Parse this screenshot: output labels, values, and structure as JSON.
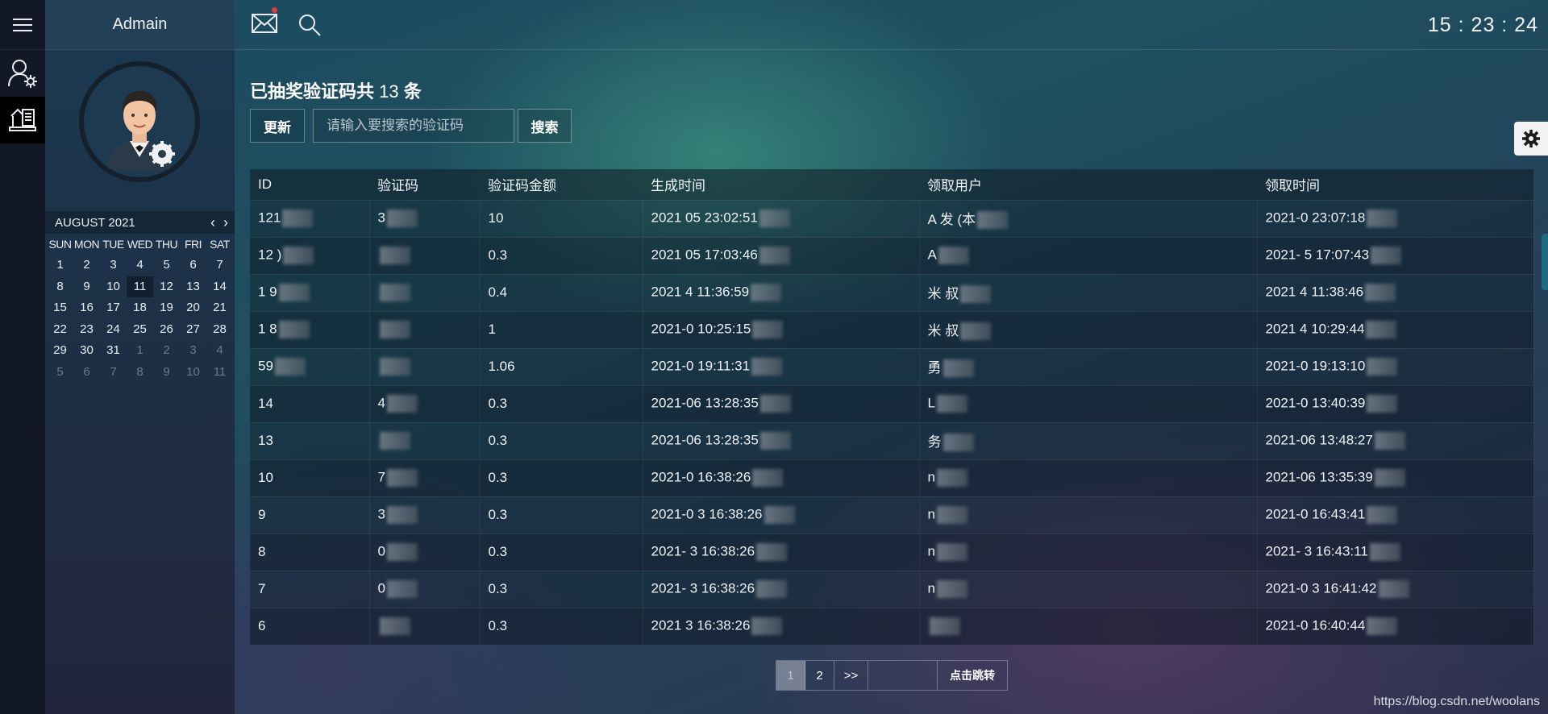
{
  "app": {
    "user_name": "Admain",
    "clock": "15 : 23 : 24"
  },
  "calendar": {
    "month_label": "AUGUST 2021",
    "weekdays": [
      "SUN",
      "MON",
      "TUE",
      "WED",
      "THU",
      "FRI",
      "SAT"
    ],
    "weeks": [
      [
        "1",
        "2",
        "3",
        "4",
        "5",
        "6",
        "7"
      ],
      [
        "8",
        "9",
        "10",
        "11",
        "12",
        "13",
        "14"
      ],
      [
        "15",
        "16",
        "17",
        "18",
        "19",
        "20",
        "21"
      ],
      [
        "22",
        "23",
        "24",
        "25",
        "26",
        "27",
        "28"
      ],
      [
        "29",
        "30",
        "31",
        "1",
        "2",
        "3",
        "4"
      ],
      [
        "5",
        "6",
        "7",
        "8",
        "9",
        "10",
        "11"
      ]
    ],
    "today": "11"
  },
  "main": {
    "title_prefix": "已抽奖验证码共",
    "title_count": "13",
    "title_suffix": "条",
    "refresh_label": "更新",
    "search_placeholder": "请输入要搜索的验证码",
    "search_label": "搜索"
  },
  "table": {
    "columns": [
      "ID",
      "验证码",
      "验证码金额",
      "生成时间",
      "领取用户",
      "领取时间"
    ],
    "rows": [
      [
        "121",
        "3",
        "10",
        "2021 05 23:02:51",
        "A 发 (本",
        "2021-0 23:07:18"
      ],
      [
        "12 )",
        "",
        "0.3",
        "2021 05 17:03:46",
        "A",
        "2021- 5 17:07:43"
      ],
      [
        "1 9",
        "",
        "0.4",
        "2021 4 11:36:59",
        "米 叔",
        "2021 4 11:38:46"
      ],
      [
        "1 8",
        "",
        "1",
        "2021-0 10:25:15",
        "米 叔",
        "2021 4 10:29:44"
      ],
      [
        "59",
        "",
        "1.06",
        "2021-0 19:11:31",
        "勇",
        "2021-0 19:13:10"
      ],
      [
        "14",
        "4",
        "0.3",
        "2021-06 13:28:35",
        "L",
        "2021-0 13:40:39"
      ],
      [
        "13",
        "",
        "0.3",
        "2021-06 13:28:35",
        "务",
        "2021-06 13:48:27"
      ],
      [
        "10",
        "7",
        "0.3",
        "2021-0 16:38:26",
        "n",
        "2021-06 13:35:39"
      ],
      [
        "9",
        "3",
        "0.3",
        "2021-0 3 16:38:26",
        "n",
        "2021-0 16:43:41"
      ],
      [
        "8",
        "0",
        "0.3",
        "2021- 3 16:38:26",
        "n",
        "2021- 3 16:43:11"
      ],
      [
        "7",
        "0",
        "0.3",
        "2021- 3 16:38:26",
        "n",
        "2021-0 3 16:41:42"
      ],
      [
        "6",
        "",
        "0.3",
        "2021 3 16:38:26",
        "",
        "2021-0 16:40:44"
      ]
    ]
  },
  "pagination": {
    "pages": [
      "1",
      "2"
    ],
    "next_label": ">>",
    "go_label": "点击跳转",
    "current": "1"
  },
  "watermark": "https://blog.csdn.net/woolans"
}
